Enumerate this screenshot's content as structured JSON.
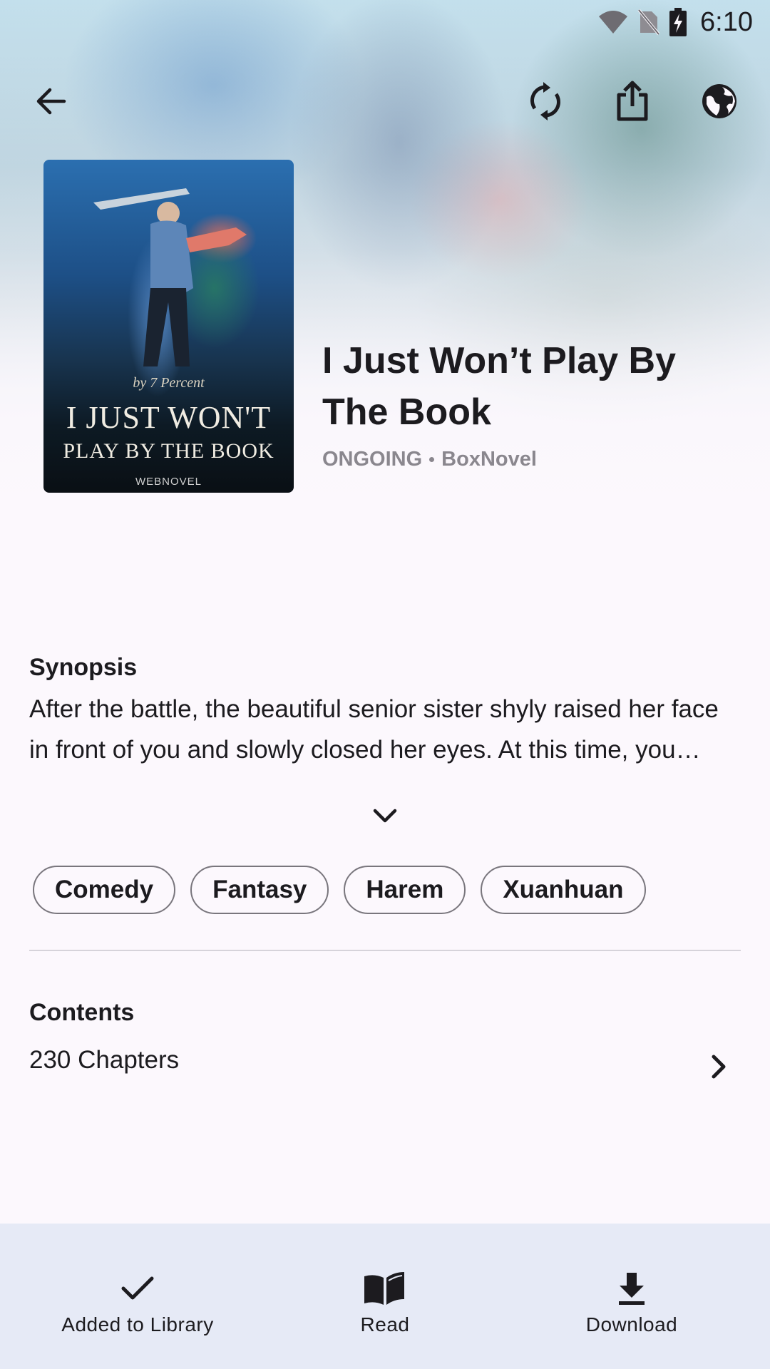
{
  "status_bar": {
    "time": "6:10",
    "icons": [
      "wifi-icon",
      "no-sim-icon",
      "battery-charging-icon"
    ]
  },
  "top_bar": {
    "icons": [
      "back-arrow-icon",
      "refresh-icon",
      "share-icon",
      "globe-icon"
    ]
  },
  "cover": {
    "author_line": "by 7 Percent",
    "title_line1": "I JUST WON'T",
    "title_line2": "PLAY BY THE BOOK",
    "publisher": "WEBNOVEL"
  },
  "book": {
    "title": "I Just Won’t Play By The Book",
    "status": "ONGOING",
    "source": "BoxNovel"
  },
  "synopsis": {
    "heading": "Synopsis",
    "text": "After the battle, the beautiful senior sister shyly raised her face in front of you and slowly closed her eyes. At this time, you…"
  },
  "genres": [
    "Comedy",
    "Fantasy",
    "Harem",
    "Xuanhuan"
  ],
  "contents": {
    "heading": "Contents",
    "count": "230 Chapters"
  },
  "actions": {
    "library": "Added to Library",
    "read": "Read",
    "download": "Download"
  },
  "colors": {
    "background": "#fcf8fd",
    "bottom_bar": "#e6eaf6",
    "meta_text": "#8a878e",
    "chip_border": "#79767d"
  }
}
